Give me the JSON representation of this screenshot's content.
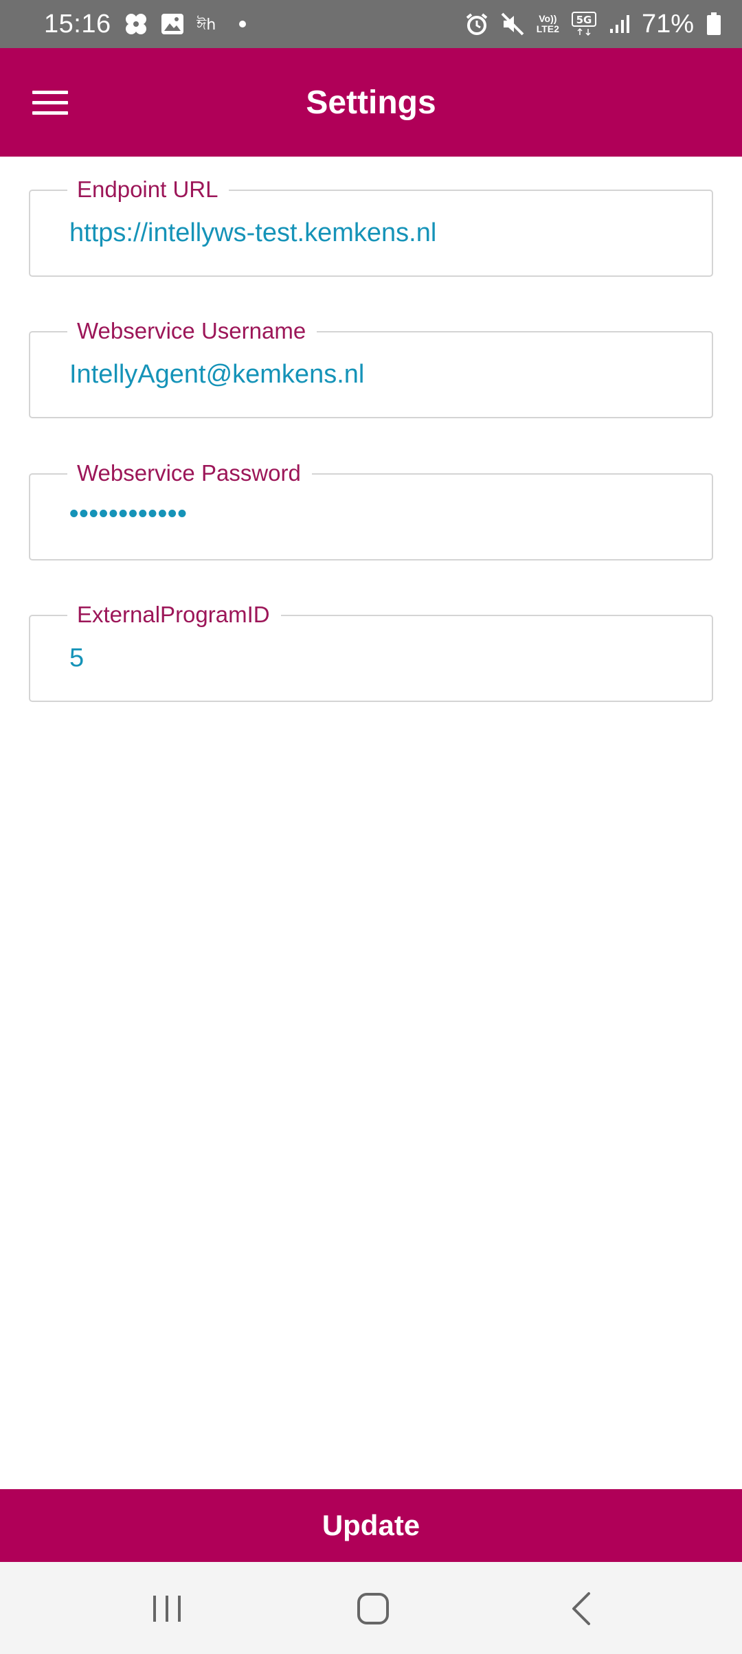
{
  "status_bar": {
    "time": "15:16",
    "battery": "71%",
    "network": "5G",
    "volte_top": "Vo))",
    "volte_bottom": "LTE2",
    "icons": [
      "pinwheel-icon",
      "gallery-icon",
      "dh-icon",
      "dot-icon",
      "alarm-icon",
      "mute-icon",
      "volte-icon",
      "5g-icon",
      "signal-icon",
      "battery-icon"
    ]
  },
  "app_bar": {
    "title": "Settings",
    "background": "#b00058"
  },
  "fields": [
    {
      "label": "Endpoint URL",
      "value": "https://intellyws-test.kemkens.nl"
    },
    {
      "label": "Webservice Username",
      "value": "IntellyAgent@kemkens.nl"
    },
    {
      "label": "Webservice Password",
      "value": "••••••••••••"
    },
    {
      "label": "ExternalProgramID",
      "value": "5"
    }
  ],
  "update_button": {
    "label": "Update"
  },
  "colors": {
    "accent": "#b00058",
    "label": "#9c1658",
    "value": "#1593b8"
  },
  "nav_bar": {
    "icons": [
      "recents-icon",
      "home-icon",
      "back-icon"
    ]
  }
}
